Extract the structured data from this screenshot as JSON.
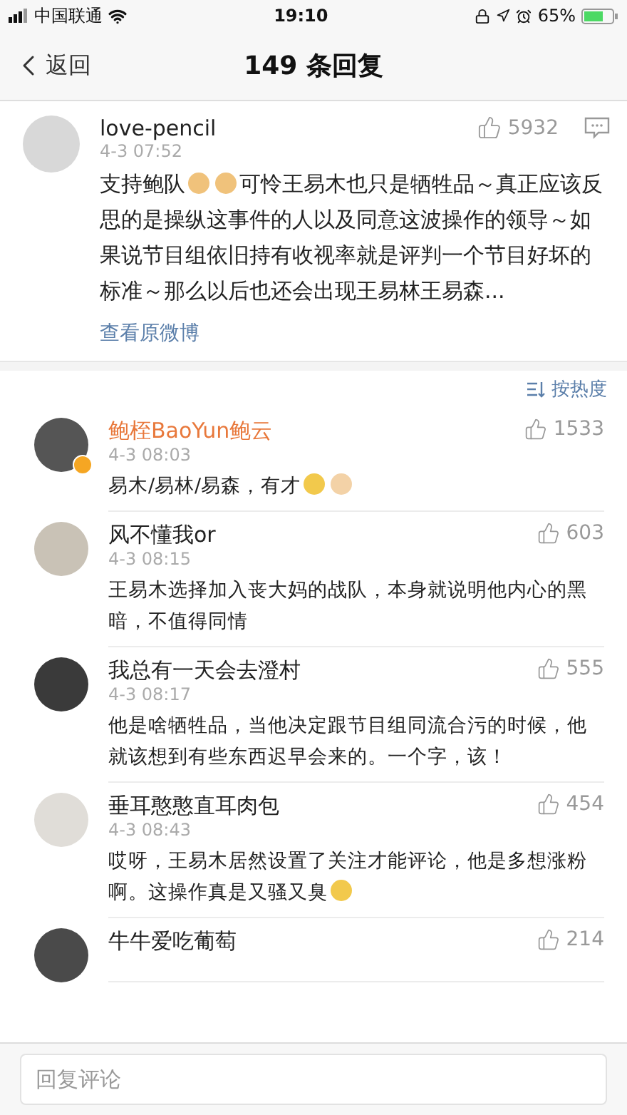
{
  "status_bar": {
    "carrier": "中国联通",
    "time": "19:10",
    "battery": "65%"
  },
  "nav": {
    "back": "返回",
    "title": "149 条回复"
  },
  "post": {
    "author": "love-pencil",
    "time": "4-3 07:52",
    "likes": "5932",
    "content": [
      {
        "kind": "text",
        "text": "支持鲍队"
      },
      {
        "kind": "fist"
      },
      {
        "kind": "fist"
      },
      {
        "kind": "text",
        "text": "可怜王易木也只是牺牲品～真正应该反思的是操纵这事件的人以及同意这波操作的领导～如果说节目组依旧持有收视率就是评判一个节目好坏的标准～那么以后也还会出现王易林王易森..."
      }
    ],
    "link": "查看原微博"
  },
  "sort": {
    "label": "按热度"
  },
  "comments": [
    {
      "author": "鲍桎BaoYun鲍云",
      "member": true,
      "verified": true,
      "time": "4-3 08:03",
      "likes": "1533",
      "content": [
        {
          "kind": "text",
          "text": "易木/易林/易森，有才"
        },
        {
          "kind": "laugh"
        },
        {
          "kind": "thumb"
        }
      ]
    },
    {
      "author": "风不懂我or",
      "member": false,
      "verified": false,
      "time": "4-3 08:15",
      "likes": "603",
      "content": [
        {
          "kind": "text",
          "text": "王易木选择加入丧大妈的战队，本身就说明他内心的黑暗，不值得同情"
        }
      ]
    },
    {
      "author": "我总有一天会去澄村",
      "member": false,
      "verified": false,
      "time": "4-3 08:17",
      "likes": "555",
      "content": [
        {
          "kind": "text",
          "text": "他是啥牺牲品，当他决定跟节目组同流合污的时候，他就该想到有些东西迟早会来的。一个字，该！"
        }
      ]
    },
    {
      "author": "垂耳憨憨直耳肉包",
      "member": false,
      "verified": false,
      "time": "4-3 08:43",
      "likes": "454",
      "content": [
        {
          "kind": "text",
          "text": "哎呀，王易木居然设置了关注才能评论，他是多想涨粉啊。这操作真是又骚又臭"
        },
        {
          "kind": "laugh"
        }
      ]
    },
    {
      "author": "牛牛爱吃葡萄",
      "member": false,
      "verified": false,
      "likes": "214"
    }
  ],
  "reply": {
    "placeholder": "回复评论"
  }
}
